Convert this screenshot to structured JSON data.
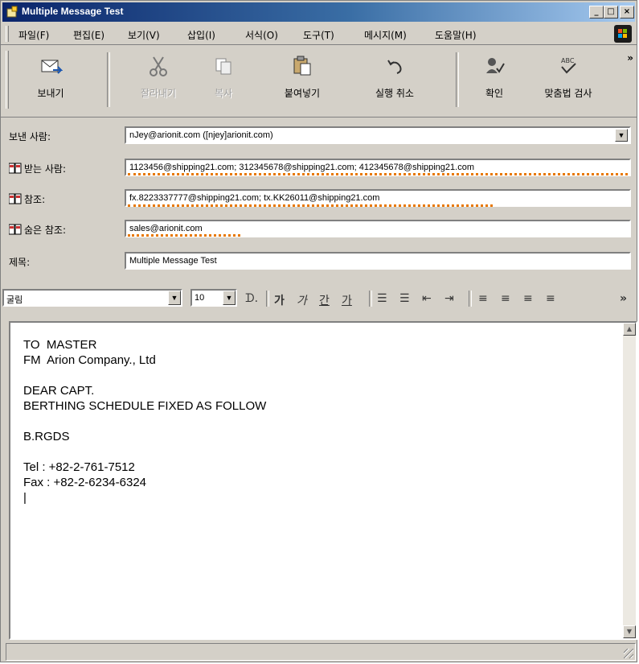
{
  "window": {
    "title": "Multiple Message Test"
  },
  "menu": [
    "파일(F)",
    "편집(E)",
    "보기(V)",
    "삽입(I)",
    "서식(O)",
    "도구(T)",
    "메시지(M)",
    "도움말(H)"
  ],
  "toolbar": {
    "send": "보내기",
    "cut": "잘라내기",
    "copy": "복사",
    "paste": "붙여넣기",
    "undo": "실행 취소",
    "check": "확인",
    "spelling": "맞춤법 검사"
  },
  "header": {
    "from_label": "보낸 사람:",
    "from_value": "nJey@arionit.com   ([njey]arionit.com)",
    "to_label": "받는 사람:",
    "to_value": "1123456@shipping21.com; 312345678@shipping21.com; 412345678@shipping21.com",
    "cc_label": "참조:",
    "cc_value": "fx.8223337777@shipping21.com; tx.KK26011@shipping21.com",
    "bcc_label": "숨은 참조:",
    "bcc_value": "sales@arionit.com",
    "subject_label": "제목:",
    "subject_value": "Multiple Message Test"
  },
  "format": {
    "font": "굴림",
    "size": "10"
  },
  "body": {
    "lines": [
      "TO  MASTER",
      "FM  Arion Company., Ltd",
      "",
      "DEAR CAPT.",
      "BERTHING SCHEDULE FIXED AS FOLLOW",
      "",
      "B.RGDS",
      "",
      "Tel : +82-2-761-7512",
      "Fax : +82-2-6234-6324",
      "|"
    ]
  },
  "colors": {
    "titlebar": "#0a246a",
    "face": "#d4d0c8",
    "squiggle": "#e87800"
  }
}
